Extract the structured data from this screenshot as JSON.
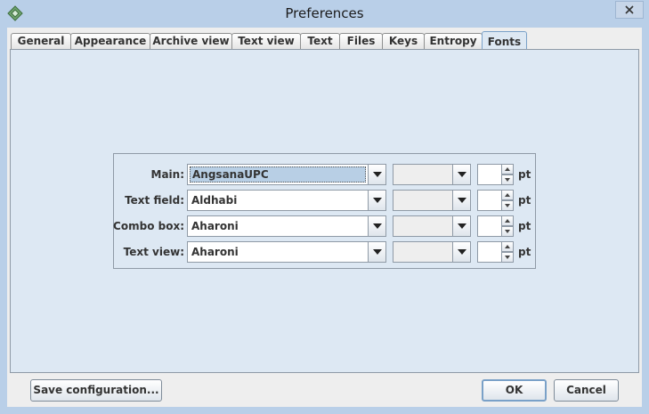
{
  "window": {
    "title": "Preferences"
  },
  "tabs": [
    {
      "label": "General"
    },
    {
      "label": "Appearance"
    },
    {
      "label": "Archive view"
    },
    {
      "label": "Text view"
    },
    {
      "label": "Text"
    },
    {
      "label": "Files"
    },
    {
      "label": "Keys"
    },
    {
      "label": "Entropy"
    },
    {
      "label": "Fonts",
      "active": true
    }
  ],
  "fonts": {
    "rows": [
      {
        "label": "Main:",
        "font": "AngsanaUPC",
        "style": "",
        "size": "",
        "unit": "pt"
      },
      {
        "label": "Text field:",
        "font": "Aldhabi",
        "style": "",
        "size": "",
        "unit": "pt"
      },
      {
        "label": "Combo box:",
        "font": "Aharoni",
        "style": "",
        "size": "",
        "unit": "pt"
      },
      {
        "label": "Text view:",
        "font": "Aharoni",
        "style": "",
        "size": "",
        "unit": "pt"
      }
    ]
  },
  "buttons": {
    "save": "Save configuration...",
    "ok": "OK",
    "cancel": "Cancel"
  },
  "colors": {
    "accent": "#7aa1c8",
    "panel": "#dde8f3",
    "titlebar": "#b9cfe8"
  }
}
